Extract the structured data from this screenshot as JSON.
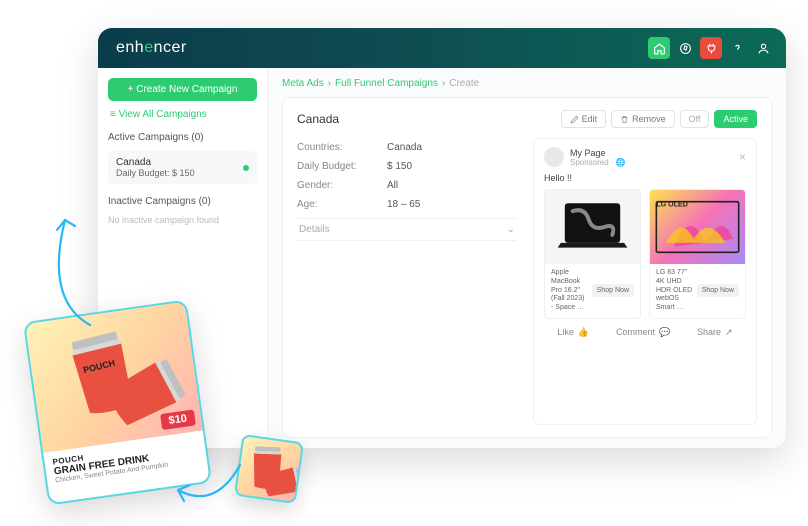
{
  "brand": {
    "pre": "enh",
    "accent": "e",
    "post": "ncer"
  },
  "sidebar": {
    "create_btn": "+ Create New Campaign",
    "view_all": "≡ View All Campaigns",
    "active_title": "Active Campaigns (0)",
    "campaign": {
      "name": "Canada",
      "budget_label": "Daily Budget:",
      "budget_value": "$  150"
    },
    "inactive_title": "Inactive Campaigns (0)",
    "inactive_empty": "No inactive campaign found"
  },
  "breadcrumb": {
    "a": "Meta Ads",
    "b": "Full Funnel Campaigns",
    "c": "Create"
  },
  "card": {
    "title": "Canada",
    "edit": "Edit",
    "remove": "Remove",
    "off": "Off",
    "active": "Active",
    "settings": {
      "countries_label": "Countries:",
      "countries_val": "Canada",
      "budget_label": "Daily Budget:",
      "budget_val": "$  150",
      "gender_label": "Gender:",
      "gender_val": "All",
      "age_label": "Age:",
      "age_val": "18  –  65"
    },
    "details": "Details"
  },
  "preview": {
    "page": "My Page",
    "sponsored": "Sponsored · ",
    "text": "Hello !!",
    "products": [
      {
        "name": "Apple MacBook Pro 16.2\" (Fall 2023) - Space …",
        "cta": "Shop Now"
      },
      {
        "name": "LG 83 77\" 4K UHD HDR OLED webOS Smart …",
        "cta": "Shop Now"
      }
    ],
    "lg_badge": "LG OLED",
    "like": "Like",
    "comment": "Comment",
    "share": "Share"
  },
  "promo": {
    "price": "$10",
    "brand": "POUCH",
    "title": "GRAIN FREE DRINK",
    "sub": "Chicken, Sweet Potato And Pumpkin"
  }
}
